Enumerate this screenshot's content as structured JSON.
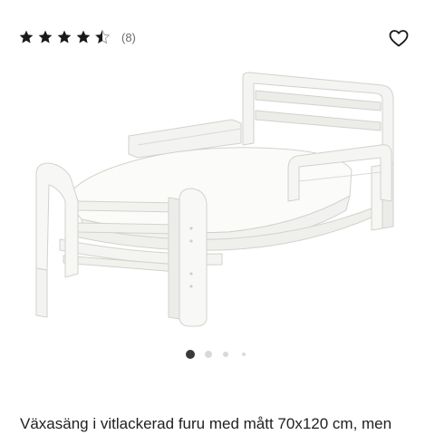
{
  "rating": {
    "value": 4.5,
    "max": 5,
    "review_count": "(8)"
  },
  "favorite": {
    "icon": "heart-outline-icon"
  },
  "product_image": {
    "alt": ""
  },
  "carousel": {
    "total": 4,
    "active_index": 0
  },
  "product": {
    "title": "Växasäng i vitlackerad furu med mått 70x120 cm, men"
  },
  "colors": {
    "star": "#1a1a1a",
    "dot_active": "#3a3a3a",
    "dot_inactive": "#d9d9d9"
  }
}
